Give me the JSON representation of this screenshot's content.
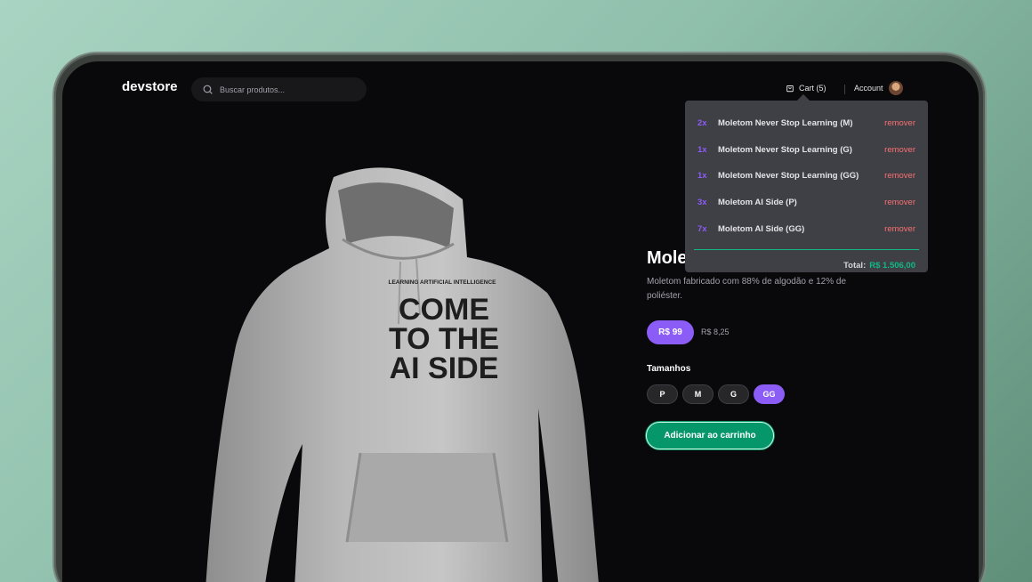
{
  "header": {
    "logo": "devstore",
    "search": {
      "placeholder": "Buscar produtos..."
    },
    "cart_label": "Cart (5)",
    "account_label": "Account"
  },
  "cart": {
    "items": [
      {
        "qty": "2x",
        "name": "Moletom Never Stop Learning (M)",
        "action": "remover"
      },
      {
        "qty": "1x",
        "name": "Moletom Never Stop Learning (G)",
        "action": "remover"
      },
      {
        "qty": "1x",
        "name": "Moletom Never Stop Learning (GG)",
        "action": "remover"
      },
      {
        "qty": "3x",
        "name": "Moletom AI Side (P)",
        "action": "remover"
      },
      {
        "qty": "7x",
        "name": "Moletom AI Side (GG)",
        "action": "remover"
      }
    ],
    "total_label": "Total:",
    "total_value": "R$ 1.506,00"
  },
  "product": {
    "title": "Moletom AI Side",
    "description": "Moletom fabricado com 88% de algodão e 12% de poliéster.",
    "price": "R$ 99",
    "installment": "R$ 8,25",
    "print": {
      "top_line": "LEARNING ARTIFICIAL INTELLIGENCE",
      "line1": "COME",
      "line2": "TO THE",
      "line3": "AI SIDE"
    }
  },
  "sizes": {
    "label": "Tamanhos",
    "options": [
      "P",
      "M",
      "G",
      "GG"
    ],
    "selected": "GG"
  },
  "add_to_cart_label": "Adicionar ao carrinho",
  "colors": {
    "accent": "#8b5cf6",
    "success": "#059669",
    "danger": "#f87171",
    "background": "#09090b"
  }
}
